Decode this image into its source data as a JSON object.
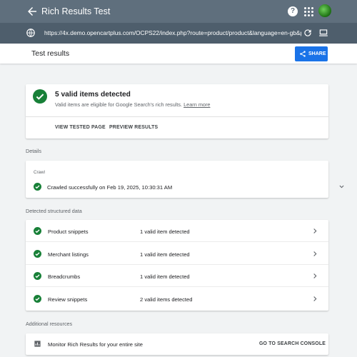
{
  "appbar": {
    "title": "Rich Results Test"
  },
  "urlbar": {
    "url": "https://4x.demo.opencartplus.com/OCPS22/index.php?route=product/product&language=en-gb&pro..."
  },
  "header": {
    "title": "Test results",
    "share_label": "SHARE"
  },
  "summary": {
    "title": "5 valid items detected",
    "subtitle": "Valid items are eligible for Google Search's rich results.",
    "learn_more": "Learn more",
    "actions": [
      "VIEW TESTED PAGE",
      "PREVIEW RESULTS"
    ]
  },
  "details": {
    "label": "Details",
    "crawl_label": "Crawl",
    "crawl_status": "Crawled successfully on Feb 19, 2025, 10:30:31 AM"
  },
  "detected": {
    "label": "Detected structured data",
    "rows": [
      {
        "name": "Product snippets",
        "status": "1 valid item detected"
      },
      {
        "name": "Merchant listings",
        "status": "1 valid item detected"
      },
      {
        "name": "Breadcrumbs",
        "status": "1 valid item detected"
      },
      {
        "name": "Review snippets",
        "status": "2 valid items detected"
      }
    ]
  },
  "resources": {
    "label": "Additional resources",
    "monitor_text": "Monitor Rich Results for your entire site",
    "console_label": "GO TO SEARCH CONSOLE"
  },
  "colors": {
    "appbar": "#5f6f7d",
    "urlbar": "#4e5e6c",
    "accent": "#1a73e8",
    "success": "#188038"
  },
  "icons": [
    "back-arrow-icon",
    "help-icon",
    "apps-icon",
    "avatar",
    "globe-icon",
    "reload-icon",
    "laptop-icon",
    "share-icon",
    "check-circle-icon",
    "chevron-down-icon",
    "chevron-right-icon",
    "chart-icon"
  ]
}
